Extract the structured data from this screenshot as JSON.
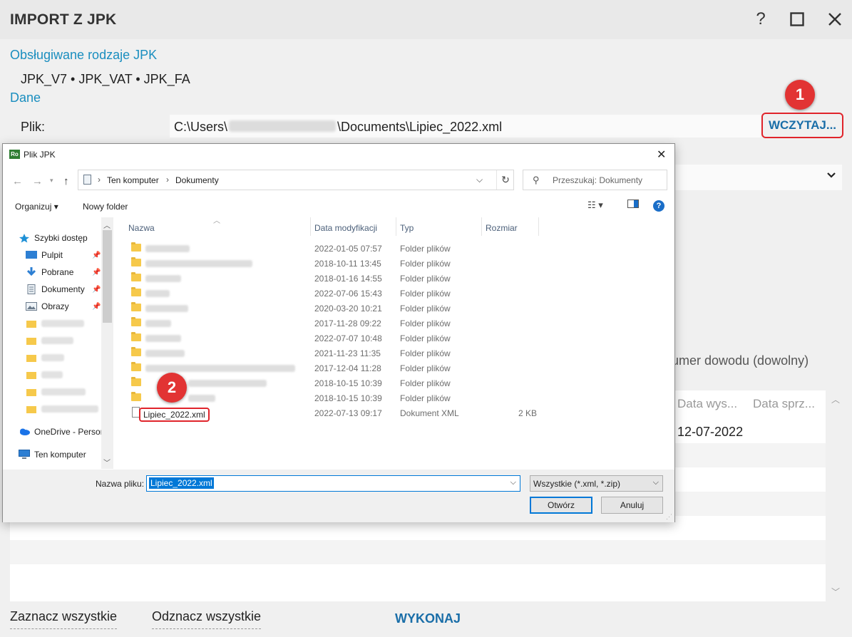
{
  "window": {
    "title": "IMPORT Z JPK",
    "help_glyph": "?",
    "maximize_glyph": "☐",
    "close_glyph": "✕"
  },
  "supported": {
    "heading": "Obsługiwane rodzaje JPK",
    "types": "JPK_V7 • JPK_VAT • JPK_FA"
  },
  "data_section": {
    "heading": "Dane",
    "file_label": "Plik:",
    "path_prefix": "C:\\Users\\",
    "path_suffix": "\\Documents\\Lipiec_2022.xml",
    "load_button": "WCZYTAJ..."
  },
  "markers": {
    "one": "1",
    "two": "2"
  },
  "numer_label": "umer dowodu (dowolny)",
  "background_table": {
    "columns": [
      "Data wys...",
      "Data sprz..."
    ],
    "first_row_value": "12-07-2022"
  },
  "bottom_bar": {
    "select_all": "Zaznacz wszystkie",
    "deselect_all": "Odznacz wszystkie",
    "execute": "WYKONAJ"
  },
  "file_dialog": {
    "title_icon": "Ro",
    "title": "Plik JPK",
    "close_glyph": "✕",
    "nav": {
      "back": "←",
      "forward": "→",
      "up": "↑"
    },
    "address": [
      "Ten komputer",
      "Dokumenty"
    ],
    "search_placeholder": "Przeszukaj: Dokumenty",
    "toolbar": {
      "organize": "Organizuj ▾",
      "new_folder": "Nowy folder"
    },
    "nav_pane": [
      {
        "label": "Szybki dostęp",
        "icon": "star-icon",
        "color": "#1e90d6"
      },
      {
        "label": "Pulpit",
        "icon": "desktop-icon",
        "color": "#2d7fd3"
      },
      {
        "label": "Pobrane",
        "icon": "download-icon",
        "color": "#2d7fd3"
      },
      {
        "label": "Dokumenty",
        "icon": "document-icon",
        "color": "#6b7b8c"
      },
      {
        "label": "Obrazy",
        "icon": "pictures-icon",
        "color": "#6b7b8c"
      },
      {
        "label": "OneDrive - Persor",
        "icon": "onedrive-icon",
        "color": "#1a73e8"
      },
      {
        "label": "Ten komputer",
        "icon": "computer-icon",
        "color": "#2d7fd3"
      }
    ],
    "columns": {
      "name": "Nazwa",
      "modified": "Data modyfikacji",
      "type": "Typ",
      "size": "Rozmiar"
    },
    "folders": [
      {
        "date": "2022-01-05 07:57",
        "type": "Folder plików"
      },
      {
        "date": "2018-10-11 13:45",
        "type": "Folder plików"
      },
      {
        "date": "2018-01-16 14:55",
        "type": "Folder plików"
      },
      {
        "date": "2022-07-06 15:43",
        "type": "Folder plików"
      },
      {
        "date": "2020-03-20 10:21",
        "type": "Folder plików"
      },
      {
        "date": "2017-11-28 09:22",
        "type": "Folder plików"
      },
      {
        "date": "2022-07-07 10:48",
        "type": "Folder plików"
      },
      {
        "date": "2021-11-23 11:35",
        "type": "Folder plików"
      },
      {
        "date": "2017-12-04 11:28",
        "type": "Folder plików"
      },
      {
        "date": "2018-10-15 10:39",
        "type": "Folder plików"
      },
      {
        "date": "2018-10-15 10:39",
        "type": "Folder plików"
      }
    ],
    "xml_file": {
      "name": "Lipiec_2022.xml",
      "date": "2022-07-13 09:17",
      "type": "Dokument XML",
      "size": "2 KB"
    },
    "filename_label": "Nazwa pliku:",
    "filename_value": "Lipiec_2022.xml",
    "filetype": "Wszystkie (*.xml, *.zip)",
    "open_button": "Otwórz",
    "cancel_button": "Anuluj"
  },
  "colors": {
    "accent_blue": "#1a8ebf",
    "button_blue": "#1a6ea8",
    "highlight_red": "#e0242b",
    "selection_blue": "#0078d7"
  }
}
